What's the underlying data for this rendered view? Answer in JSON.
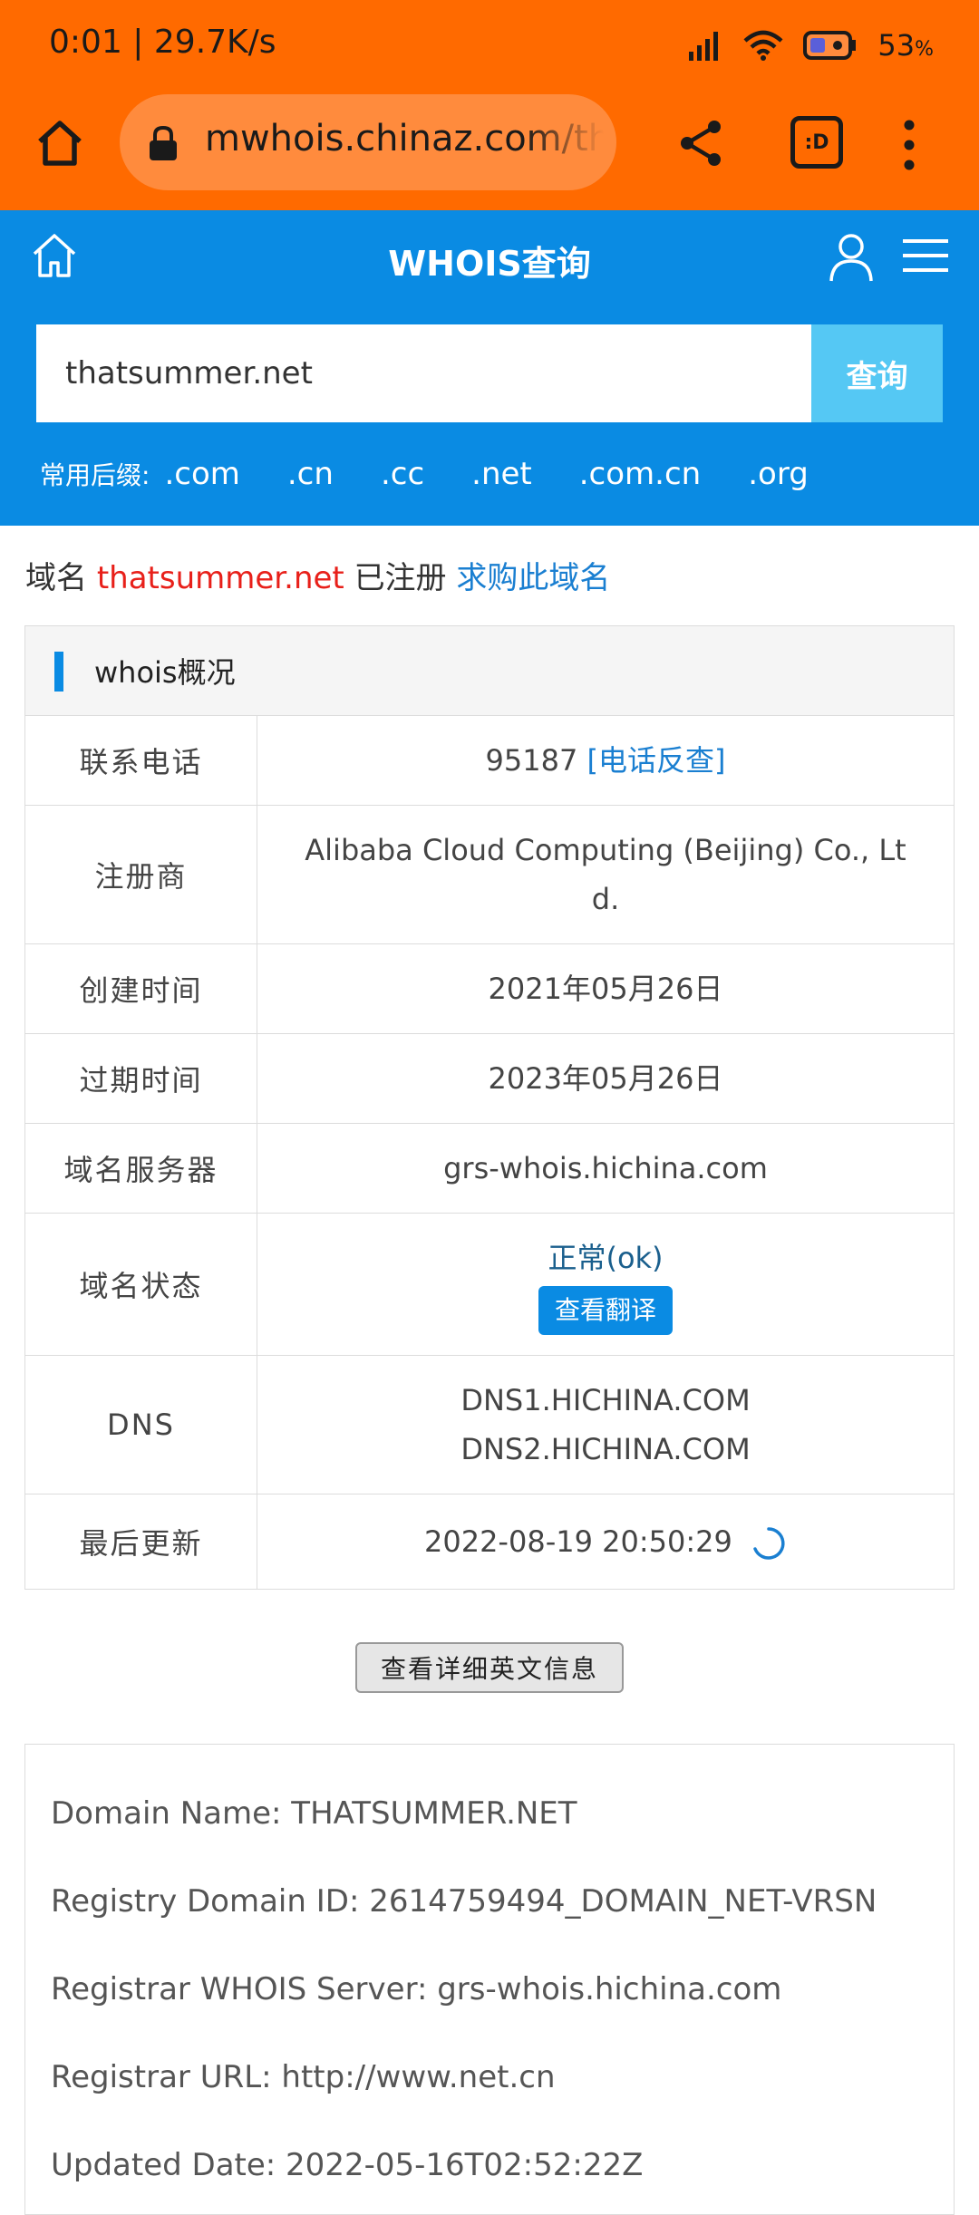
{
  "status": {
    "time": "0:01",
    "speed": "29.7K/s",
    "battery": "53",
    "battery_unit": "%"
  },
  "browser": {
    "url": "mwhois.chinaz.com/thatsummer.net",
    "tabs_label": ":D"
  },
  "header": {
    "title": "WHOIS查询"
  },
  "search": {
    "value": "thatsummer.net",
    "button_label": "查询"
  },
  "suffixes": {
    "label": "常用后缀:",
    "items": [
      ".com",
      ".cn",
      ".cc",
      ".net",
      ".com.cn",
      ".org"
    ]
  },
  "registered": {
    "prefix": "域名",
    "domain": "thatsummer.net",
    "status": "已注册",
    "buy_link": "求购此域名"
  },
  "whois": {
    "title": "whois概况",
    "rows": [
      {
        "label": "联系电话",
        "value": "95187",
        "link": "[电话反查]"
      },
      {
        "label": "注册商",
        "value": "Alibaba Cloud Computing (Beijing) Co., Lt",
        "value2": "d."
      },
      {
        "label": "创建时间",
        "value": "2021年05月26日"
      },
      {
        "label": "过期时间",
        "value": "2023年05月26日"
      },
      {
        "label": "域名服务器",
        "value": "grs-whois.hichina.com"
      },
      {
        "label": "域名状态",
        "value": "正常(ok)",
        "button": "查看翻译"
      },
      {
        "label": "DNS",
        "value": "DNS1.HICHINA.COM",
        "value2": "DNS2.HICHINA.COM"
      },
      {
        "label": "最后更新",
        "value": "2022-08-19 20:50:29"
      }
    ]
  },
  "detail_button": "查看详细英文信息",
  "raw": [
    "Domain Name: THATSUMMER.NET",
    "Registry Domain ID: 2614759494_DOMAIN_NET-VRSN",
    "Registrar WHOIS Server: grs-whois.hichina.com",
    "Registrar URL: http://www.net.cn",
    "Updated Date: 2022-05-16T02:52:22Z"
  ],
  "colors": {
    "browser_bar": "#ff6a00",
    "site_blue": "#0a8be3",
    "search_button": "#55c8f4",
    "domain_red": "#e8201a"
  },
  "icons": [
    "home-icon",
    "lock-icon",
    "share-icon",
    "tabs-icon",
    "more-vert-icon",
    "user-icon",
    "hamburger-icon",
    "refresh-spinner-icon",
    "signal-icon",
    "wifi-icon",
    "battery-icon"
  ]
}
